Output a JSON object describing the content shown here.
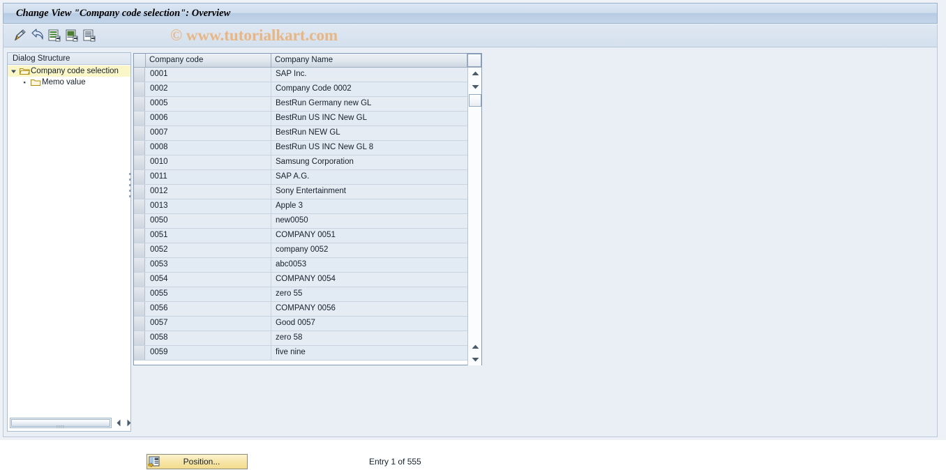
{
  "window": {
    "title": "Change View \"Company code selection\": Overview"
  },
  "watermark": "© www.tutorialkart.com",
  "toolbar": {
    "buttons": [
      {
        "name": "change-display-icon",
        "tooltip": "Display/Change"
      },
      {
        "name": "back-arrow-icon",
        "tooltip": "Back"
      },
      {
        "name": "new-entries-icon",
        "tooltip": "New Entries"
      },
      {
        "name": "copy-as-icon",
        "tooltip": "Copy As..."
      },
      {
        "name": "details-icon",
        "tooltip": "Details"
      }
    ]
  },
  "sidebar": {
    "header": "Dialog Structure",
    "tree": [
      {
        "label": "Company code selection",
        "level": 0,
        "selected": true,
        "expanded": true,
        "icon": "open-folder-icon"
      },
      {
        "label": "Memo value",
        "level": 1,
        "selected": false,
        "expanded": false,
        "icon": "closed-folder-icon"
      }
    ],
    "hscroll": {
      "left_arrow": "◀",
      "right_arrow": "▶"
    }
  },
  "table": {
    "columns": [
      "Company code",
      "Company Name"
    ],
    "rows": [
      {
        "code": "0001",
        "name": "SAP Inc."
      },
      {
        "code": "0002",
        "name": "Company Code 0002"
      },
      {
        "code": "0005",
        "name": "BestRun Germany new GL"
      },
      {
        "code": "0006",
        "name": "BestRun US INC New GL"
      },
      {
        "code": "0007",
        "name": "BestRun NEW GL"
      },
      {
        "code": "0008",
        "name": "BestRun US INC New GL 8"
      },
      {
        "code": "0010",
        "name": "Samsung Corporation"
      },
      {
        "code": "0011",
        "name": "SAP A.G."
      },
      {
        "code": "0012",
        "name": "Sony Entertainment"
      },
      {
        "code": "0013",
        "name": "Apple 3"
      },
      {
        "code": "0050",
        "name": "new0050"
      },
      {
        "code": "0051",
        "name": "COMPANY 0051"
      },
      {
        "code": "0052",
        "name": "company 0052"
      },
      {
        "code": "0053",
        "name": "abc0053"
      },
      {
        "code": "0054",
        "name": "COMPANY 0054"
      },
      {
        "code": "0055",
        "name": "zero 55"
      },
      {
        "code": "0056",
        "name": "COMPANY 0056"
      },
      {
        "code": "0057",
        "name": "Good 0057"
      },
      {
        "code": "0058",
        "name": "zero 58"
      },
      {
        "code": "0059",
        "name": "five nine"
      }
    ]
  },
  "footer": {
    "position_button_label": "Position...",
    "entry_info": "Entry 1 of 555"
  },
  "colors": {
    "title_bar": "#cfddee",
    "selected_tree_row": "#fbf6c8",
    "table_row": "#e2eaf3",
    "button_accent": "#f7e6a8",
    "watermark": "#e8b683"
  }
}
